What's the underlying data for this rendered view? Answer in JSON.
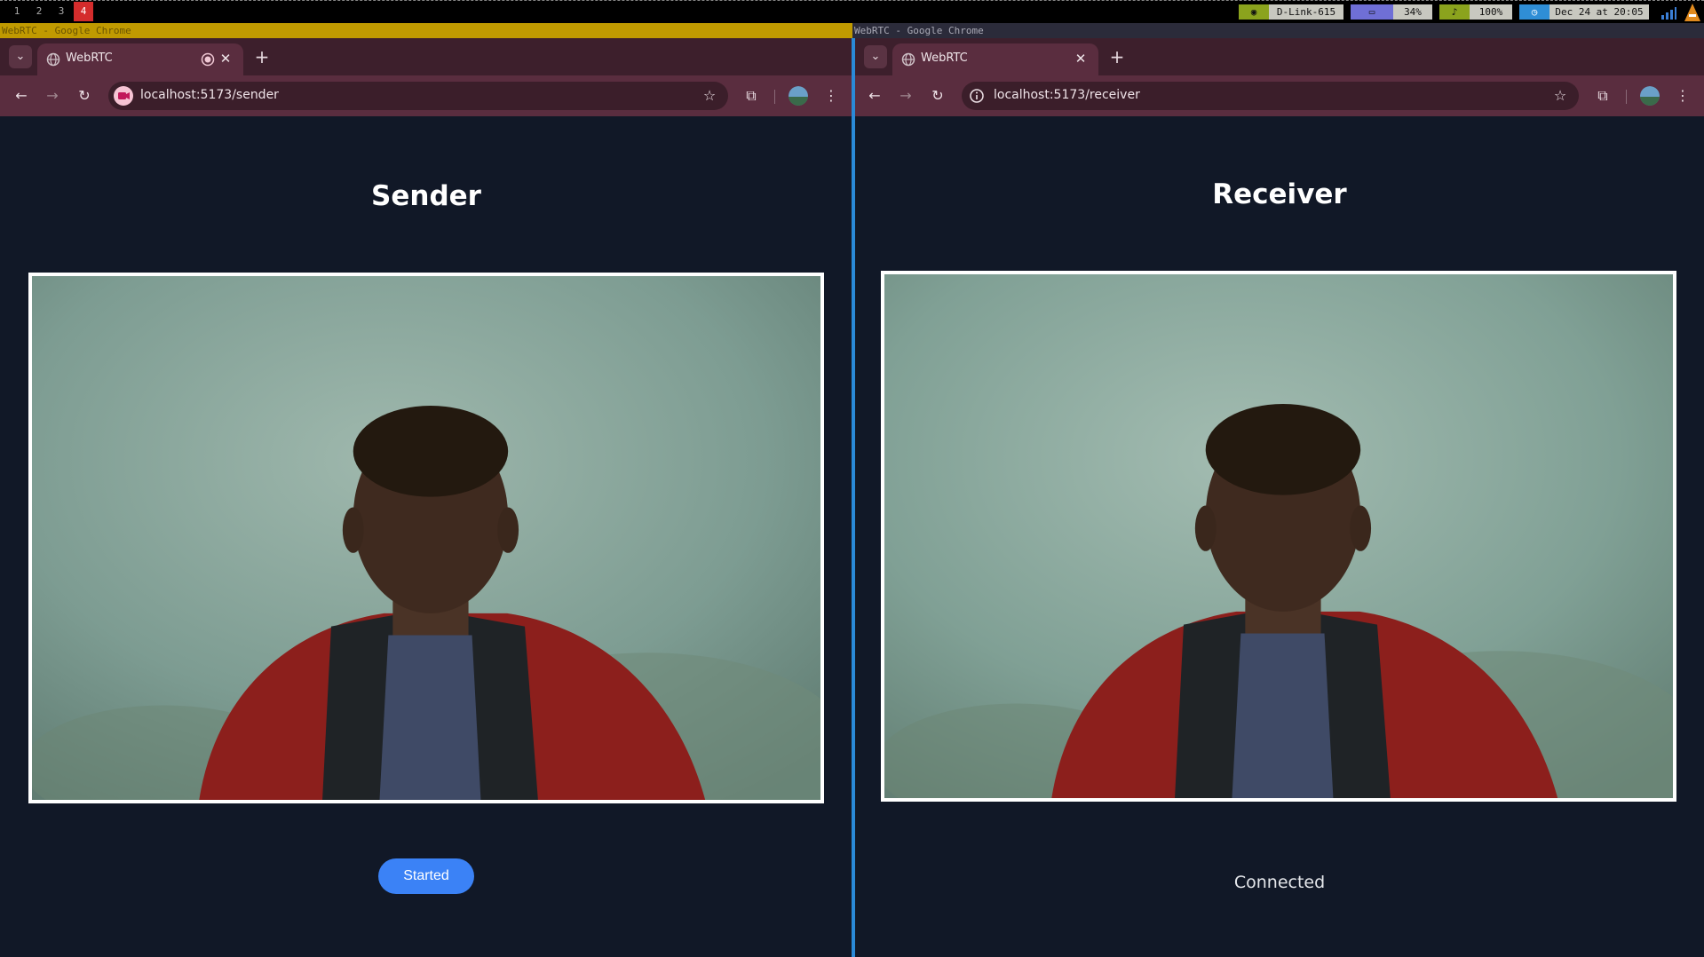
{
  "taskbar": {
    "workspaces": [
      "1",
      "2",
      "3",
      "4"
    ],
    "active_workspace": "4",
    "network": "D-Link-615",
    "memory": "34%",
    "volume": "100%",
    "clock": "Dec 24 at 20:05"
  },
  "left_window": {
    "title": "WebRTC - Google Chrome",
    "tab_title": "WebRTC",
    "url": "localhost:5173/sender",
    "heading": "Sender",
    "button_label": "Started"
  },
  "right_window": {
    "title": "WebRTC - Google Chrome",
    "tab_title": "WebRTC",
    "url": "localhost:5173/receiver",
    "heading": "Receiver",
    "status": "Connected"
  },
  "colors": {
    "page_background": "#111827",
    "button": "#3b82f6",
    "browser_frame": "#5a2d3f",
    "active_border": "#2a8ad8"
  }
}
